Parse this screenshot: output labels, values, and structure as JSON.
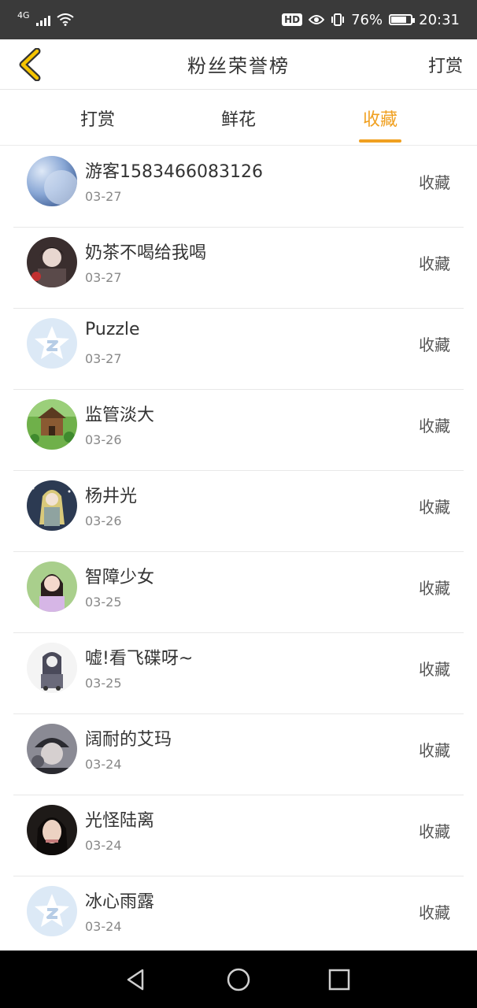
{
  "status_bar": {
    "network": "4G",
    "battery": "76%",
    "time": "20:31",
    "hd_badge": "HD"
  },
  "header": {
    "title": "粉丝荣誉榜",
    "right_action": "打赏"
  },
  "tabs": [
    {
      "label": "打赏",
      "active": false
    },
    {
      "label": "鲜花",
      "active": false
    },
    {
      "label": "收藏",
      "active": true
    }
  ],
  "colors": {
    "accent": "#f0a020",
    "status_bar_bg": "#3a3a3a",
    "nav_bar_bg": "#000000"
  },
  "list": [
    {
      "name": "游客1583466083126",
      "date": "03-27",
      "action": "收藏",
      "avatar": "moon-avatar"
    },
    {
      "name": "奶茶不喝给我喝",
      "date": "03-27",
      "action": "收藏",
      "avatar": "dark-anime-avatar"
    },
    {
      "name": "Puzzle",
      "date": "03-27",
      "action": "收藏",
      "avatar": "default-star-avatar"
    },
    {
      "name": "监管淡大",
      "date": "03-26",
      "action": "收藏",
      "avatar": "house-avatar"
    },
    {
      "name": "杨井光",
      "date": "03-26",
      "action": "收藏",
      "avatar": "anime-girl-avatar"
    },
    {
      "name": "智障少女",
      "date": "03-25",
      "action": "收藏",
      "avatar": "girl-photo-avatar"
    },
    {
      "name": "嘘!看飞碟呀~",
      "date": "03-25",
      "action": "收藏",
      "avatar": "sketch-avatar"
    },
    {
      "name": "阔耐的艾玛",
      "date": "03-24",
      "action": "收藏",
      "avatar": "hat-avatar"
    },
    {
      "name": "光怪陆离",
      "date": "03-24",
      "action": "收藏",
      "avatar": "portrait-avatar"
    },
    {
      "name": "冰心雨露",
      "date": "03-24",
      "action": "收藏",
      "avatar": "default-star-avatar"
    }
  ]
}
